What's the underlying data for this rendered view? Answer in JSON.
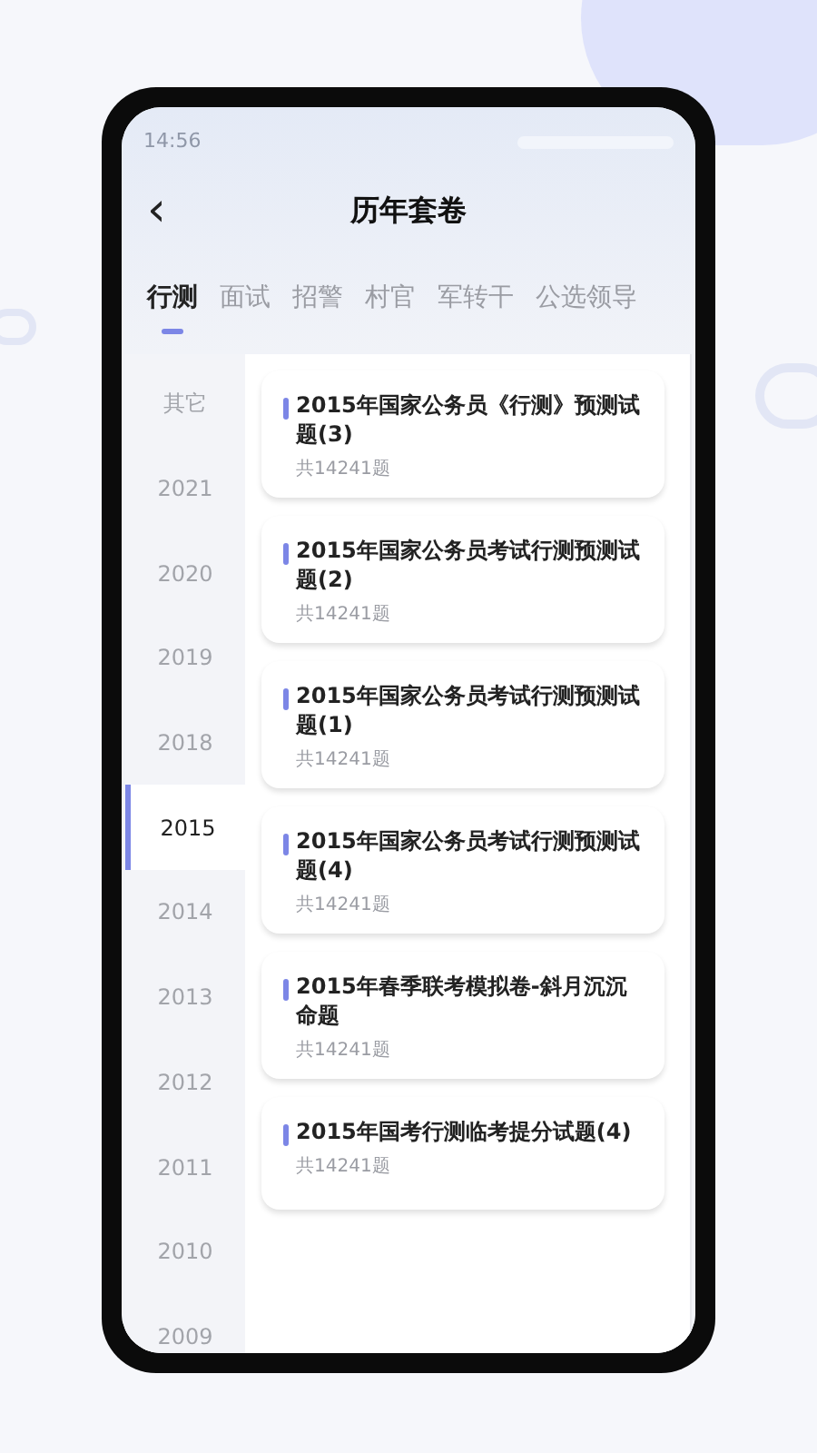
{
  "status_bar": {
    "time": "14:56"
  },
  "header": {
    "back": "‹",
    "title": "历年套卷"
  },
  "tabs": [
    {
      "label": "行测",
      "selected": true
    },
    {
      "label": "面试",
      "selected": false
    },
    {
      "label": "招警",
      "selected": false
    },
    {
      "label": "村官",
      "selected": false
    },
    {
      "label": "军转干",
      "selected": false
    },
    {
      "label": "公选领导",
      "selected": false
    }
  ],
  "years": [
    {
      "label": "其它",
      "selected": false
    },
    {
      "label": "2021",
      "selected": false
    },
    {
      "label": "2020",
      "selected": false
    },
    {
      "label": "2019",
      "selected": false
    },
    {
      "label": "2018",
      "selected": false
    },
    {
      "label": "2015",
      "selected": true
    },
    {
      "label": "2014",
      "selected": false
    },
    {
      "label": "2013",
      "selected": false
    },
    {
      "label": "2012",
      "selected": false
    },
    {
      "label": "2011",
      "selected": false
    },
    {
      "label": "2010",
      "selected": false
    },
    {
      "label": "2009",
      "selected": false
    }
  ],
  "papers": [
    {
      "title": "2015年国家公务员《行测》预测试题(3)",
      "count": "共14241题"
    },
    {
      "title": "2015年国家公务员考试行测预测试题(2)",
      "count": "共14241题"
    },
    {
      "title": "2015年国家公务员考试行测预测试题(1)",
      "count": "共14241题"
    },
    {
      "title": "2015年国家公务员考试行测预测试题(4)",
      "count": "共14241题"
    },
    {
      "title": "2015年春季联考模拟卷-斜月沉沉命题",
      "count": "共14241题"
    },
    {
      "title": "2015年国考行测临考提分试题(4)",
      "count": "共14241题"
    }
  ]
}
